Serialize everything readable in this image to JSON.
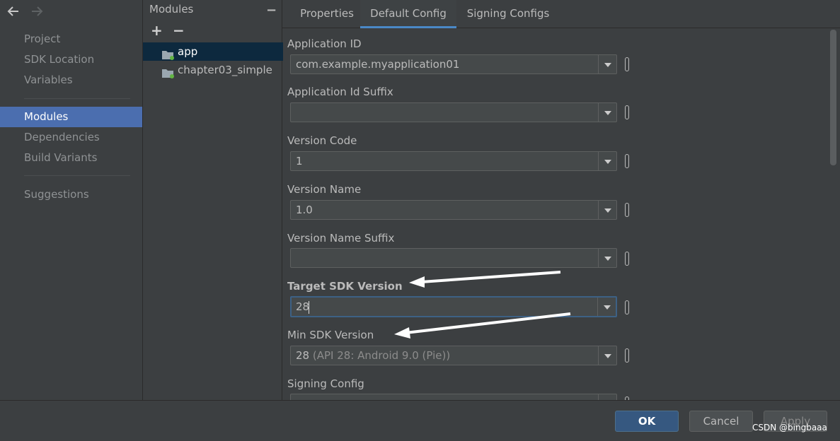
{
  "nav": {
    "back_icon": "back-arrow-icon",
    "forward_icon": "forward-arrow-icon",
    "items": [
      "Project",
      "SDK Location",
      "Variables",
      "Modules",
      "Dependencies",
      "Build Variants",
      "Suggestions"
    ],
    "selected": "Modules"
  },
  "modules": {
    "title": "Modules",
    "collapse_symbol": "−",
    "add_symbol": "+",
    "remove_symbol": "−",
    "items": [
      "app",
      "chapter03_simple"
    ],
    "selected": "app"
  },
  "tabs": [
    "Properties",
    "Default Config",
    "Signing Configs"
  ],
  "active_tab": "Default Config",
  "fields": [
    {
      "label": "Application ID",
      "value": "com.example.myapplication01"
    },
    {
      "label": "Application Id Suffix",
      "value": ""
    },
    {
      "label": "Version Code",
      "value": "1"
    },
    {
      "label": "Version Name",
      "value": "1.0"
    },
    {
      "label": "Version Name Suffix",
      "value": ""
    },
    {
      "label": "Target SDK Version",
      "value": "28"
    },
    {
      "label": "Min SDK Version",
      "value": "28",
      "hint": "(API 28: Android 9.0 (Pie))"
    },
    {
      "label": "Signing Config",
      "value": ""
    }
  ],
  "buttons": {
    "ok": "OK",
    "cancel": "Cancel",
    "apply": "Apply"
  },
  "watermark": "CSDN @bingbaaa",
  "colors": {
    "accent": "#4b6eaf",
    "tab_underline": "#4a88c7",
    "annotation_arrow": "#ffffff"
  }
}
